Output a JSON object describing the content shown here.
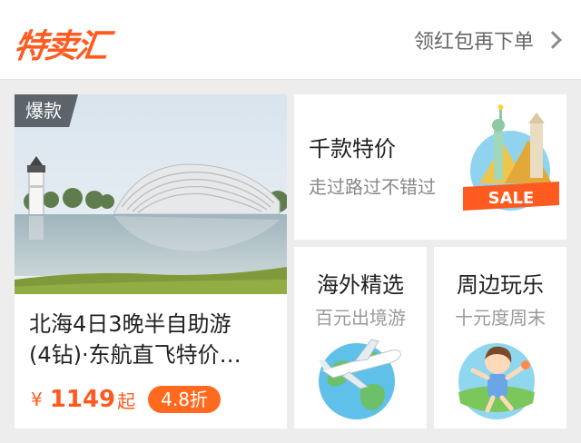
{
  "header": {
    "logo": "特卖汇",
    "link": "领红包再下单"
  },
  "featured": {
    "badge": "爆款",
    "title_line1": "北海4日3晚半自助游",
    "title_line2": "(4钻)·东航直飞特价…",
    "currency": "¥",
    "price": "1149",
    "price_suffix": "起",
    "discount": "4.8折"
  },
  "promo": {
    "title": "千款特价",
    "subtitle": "走过路过不错过",
    "sale_text": "SALE"
  },
  "overseas": {
    "title": "海外精选",
    "subtitle": "百元出境游"
  },
  "nearby": {
    "title": "周边玩乐",
    "subtitle": "十元度周末"
  },
  "colors": {
    "accent": "#ff5a1f",
    "background": "#ededed"
  }
}
